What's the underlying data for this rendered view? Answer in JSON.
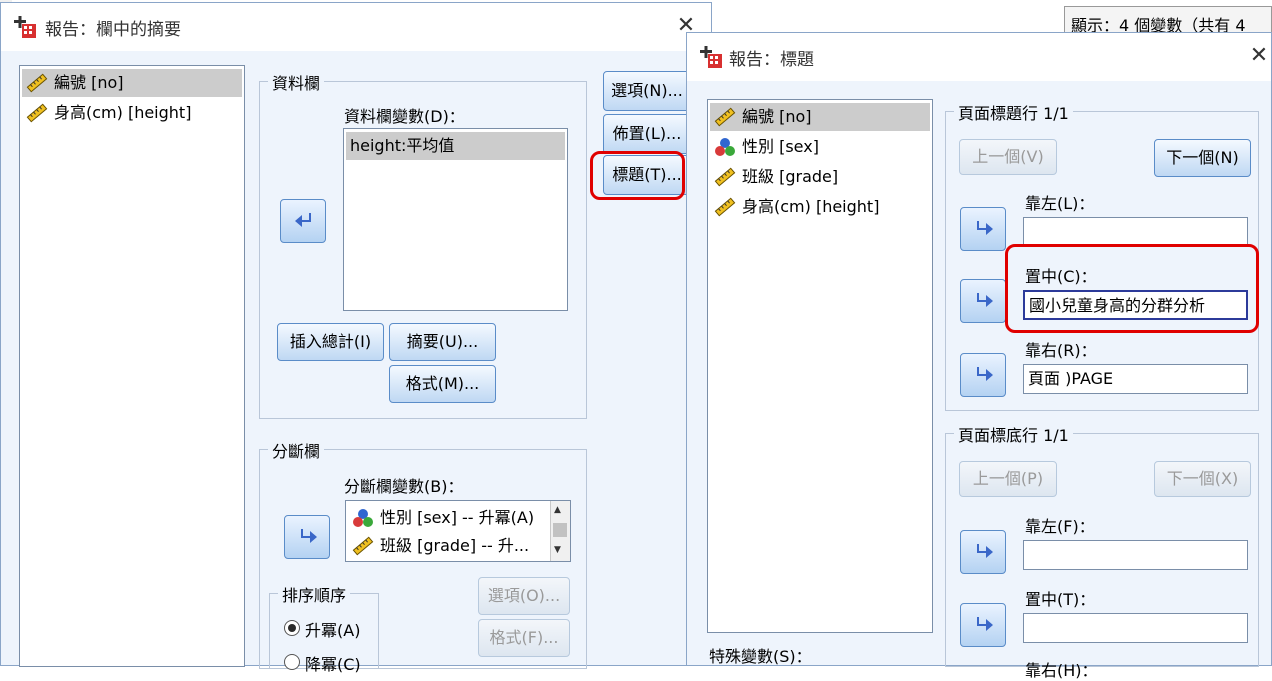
{
  "background": {
    "status_text": "顯示：4 個變數（共有 4"
  },
  "left_dialog": {
    "title": "報告：欄中的摘要",
    "source_vars": [
      {
        "label": "編號 [no]",
        "icon": "ruler-icon",
        "selected": true
      },
      {
        "label": "身高(cm) [height]",
        "icon": "ruler-icon",
        "selected": false
      }
    ],
    "data_group": {
      "label": "資料欄",
      "vars_label": "資料欄變數(D)：",
      "vars": [
        "height:平均值"
      ],
      "insert_total": "插入總計(I)",
      "summary": "摘要(U)...",
      "format": "格式(M)..."
    },
    "break_group": {
      "label": "分斷欄",
      "vars_label": "分斷欄變數(B)：",
      "vars": [
        {
          "label": "性別 [sex] -- 升冪(A)",
          "icon": "nominal-icon"
        },
        {
          "label": "班級 [grade] -- 升...",
          "icon": "ruler-icon"
        }
      ],
      "sort_label": "排序順序",
      "sort_options": [
        "升冪(A)",
        "降冪(C)"
      ],
      "options": "選項(O)...",
      "format": "格式(F)..."
    },
    "side_buttons": [
      "選項(N)...",
      "佈置(L)...",
      "標題(T)..."
    ]
  },
  "right_dialog": {
    "title": "報告：標題",
    "vars": [
      {
        "label": "編號 [no]",
        "icon": "ruler-icon",
        "selected": true
      },
      {
        "label": "性別 [sex]",
        "icon": "nominal-icon",
        "selected": false
      },
      {
        "label": "班級 [grade]",
        "icon": "ruler-icon",
        "selected": false
      },
      {
        "label": "身高(cm) [height]",
        "icon": "ruler-icon",
        "selected": false
      }
    ],
    "special_label": "特殊變數(S)：",
    "header_group": {
      "label": "頁面標題行 1/1",
      "prev": "上一個(V)",
      "next": "下一個(N)",
      "left_label": "靠左(L)：",
      "left_value": "",
      "center_label": "置中(C)：",
      "center_value": "國小兒童身高的分群分析",
      "right_label": "靠右(R)：",
      "right_value": "頁面 )PAGE"
    },
    "footer_group": {
      "label": "頁面標底行 1/1",
      "prev": "上一個(P)",
      "next": "下一個(X)",
      "left_label": "靠左(F)：",
      "left_value": "",
      "center_label": "置中(T)：",
      "center_value": "",
      "right_label": "靠右(H)："
    }
  }
}
